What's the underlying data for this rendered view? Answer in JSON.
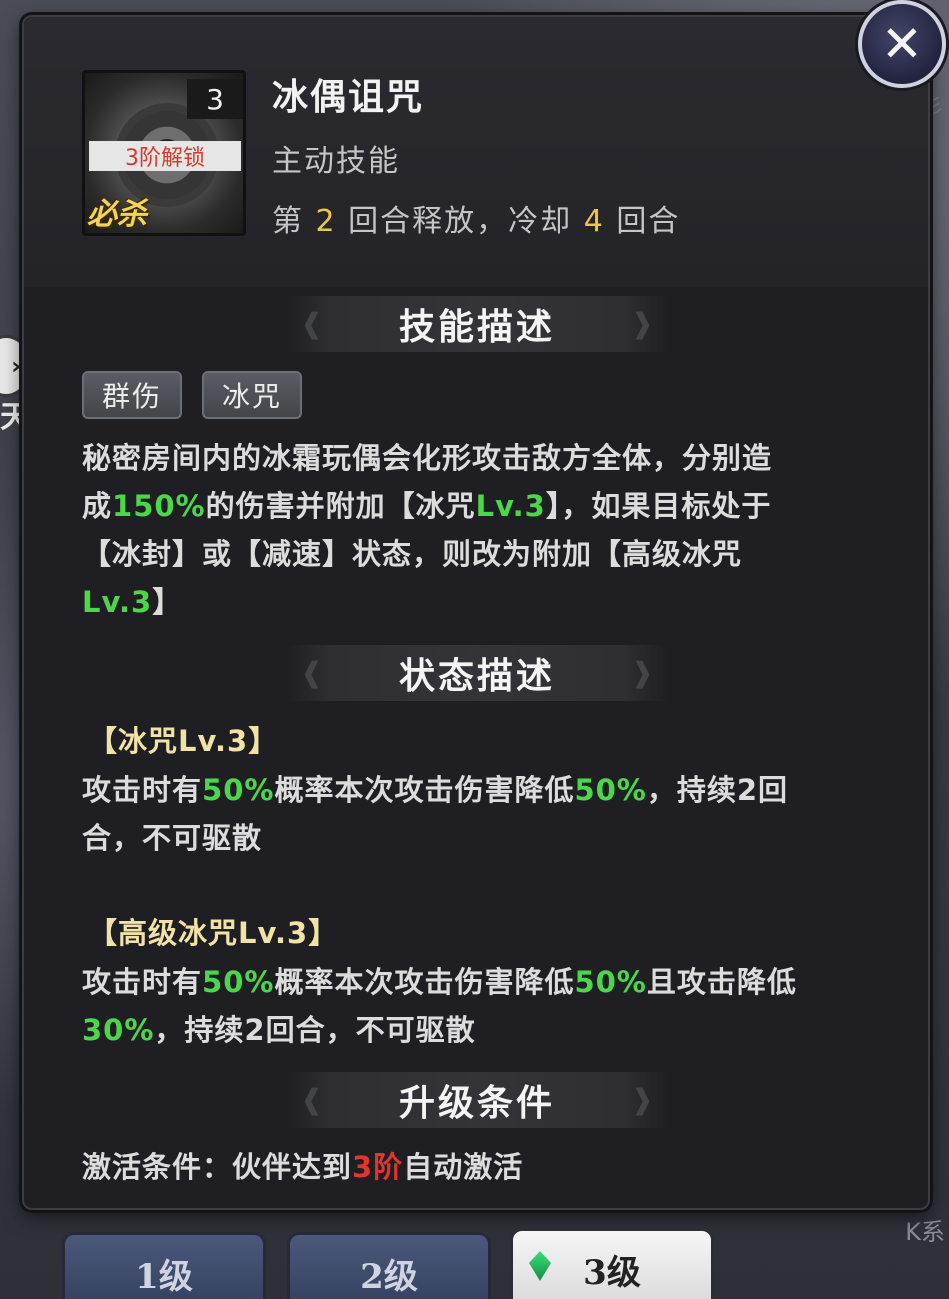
{
  "skill": {
    "level": "3",
    "unlock_label": "3阶解锁",
    "ultimate_tag": "必杀",
    "name": "冰偶诅咒",
    "type": "主动技能",
    "timing_prefix": "第 ",
    "timing_round": "2",
    "timing_mid": " 回合释放，冷却 ",
    "timing_cooldown": "4",
    "timing_suffix": " 回合"
  },
  "sections": {
    "skill_desc": "技能描述",
    "status_desc": "状态描述",
    "upgrade": "升级条件"
  },
  "tags": [
    "群伤",
    "冰咒"
  ],
  "description": {
    "p1": "秘密房间内的冰霜玩偶会化形攻击敌方全体，分别造",
    "p2a": "成",
    "p2b": "150%",
    "p2c": "的伤害并附加【冰咒",
    "p2d": "Lv.3",
    "p2e": "】，如果目标处于",
    "p3": "【冰封】或【减速】状态，则改为附加【高级冰咒",
    "p4a": "Lv.3",
    "p4b": "】"
  },
  "status1": {
    "title": "【冰咒Lv.3】",
    "l1a": "攻击时有",
    "l1b": "50%",
    "l1c": "概率本次攻击伤害降低",
    "l1d": "50%",
    "l1e": "，持续2回",
    "l2": "合，不可驱散"
  },
  "status2": {
    "title": "【高级冰咒Lv.3】",
    "l1a": "攻击时有",
    "l1b": "50%",
    "l1c": "概率本次攻击伤害降低",
    "l1d": "50%",
    "l1e": "且攻击降低",
    "l2a": "30%",
    "l2b": "，持续2回合，不可驱散"
  },
  "upgrade": {
    "prefix": "激活条件：伙伴达到",
    "highlight": "3阶",
    "suffix": "自动激活"
  },
  "tabs": [
    "1级",
    "2级",
    "3级"
  ],
  "active_tab": "3级",
  "background": {
    "left_label": "天",
    "right_label": "彡",
    "right_bottom_label": "K系"
  },
  "colors": {
    "highlight_green": "#4ad84a",
    "highlight_yellow": "#e8c84a",
    "highlight_red": "#e2352b"
  },
  "icons": [
    "close-icon",
    "arrow-icon",
    "gem-icon"
  ]
}
